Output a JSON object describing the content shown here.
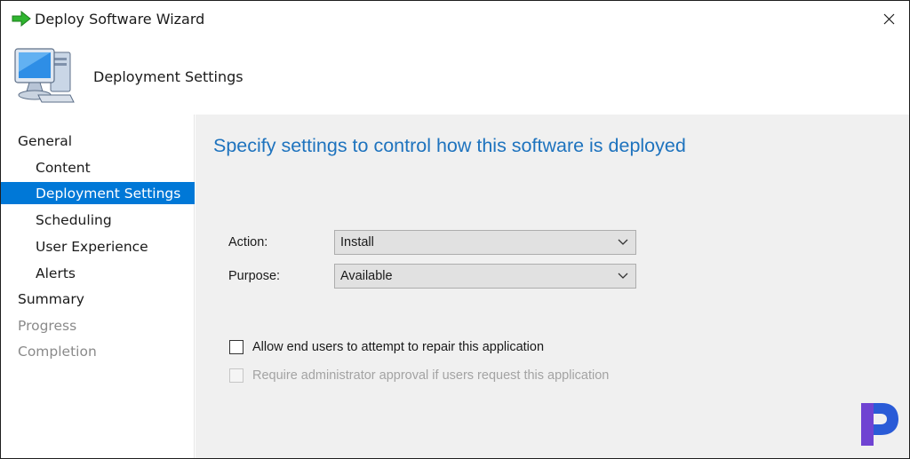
{
  "window": {
    "title": "Deploy Software Wizard",
    "title_icon": "green-arrow-icon",
    "close_icon": "close-icon"
  },
  "header": {
    "title": "Deployment Settings",
    "icon": "computer-icon"
  },
  "sidebar": {
    "items": [
      {
        "label": "General",
        "level": 0,
        "state": "normal"
      },
      {
        "label": "Content",
        "level": 1,
        "state": "normal"
      },
      {
        "label": "Deployment Settings",
        "level": 1,
        "state": "selected"
      },
      {
        "label": "Scheduling",
        "level": 1,
        "state": "normal"
      },
      {
        "label": "User Experience",
        "level": 1,
        "state": "normal"
      },
      {
        "label": "Alerts",
        "level": 1,
        "state": "normal"
      },
      {
        "label": "Summary",
        "level": 0,
        "state": "normal"
      },
      {
        "label": "Progress",
        "level": 0,
        "state": "disabled"
      },
      {
        "label": "Completion",
        "level": 0,
        "state": "disabled"
      }
    ]
  },
  "main": {
    "heading": "Specify settings to control how this software is deployed",
    "action": {
      "label": "Action:",
      "value": "Install"
    },
    "purpose": {
      "label": "Purpose:",
      "value": "Available"
    },
    "checkboxes": [
      {
        "label": "Allow end users to attempt to repair this application",
        "checked": false,
        "enabled": true
      },
      {
        "label": "Require administrator approval if users request this application",
        "checked": false,
        "enabled": false
      }
    ]
  },
  "colors": {
    "accent": "#0078d7",
    "heading": "#1e73be",
    "pane_background": "#f0f0f0",
    "disabled_text": "#8a8a8a"
  },
  "brand": {
    "icon": "brand-logo-icon"
  }
}
